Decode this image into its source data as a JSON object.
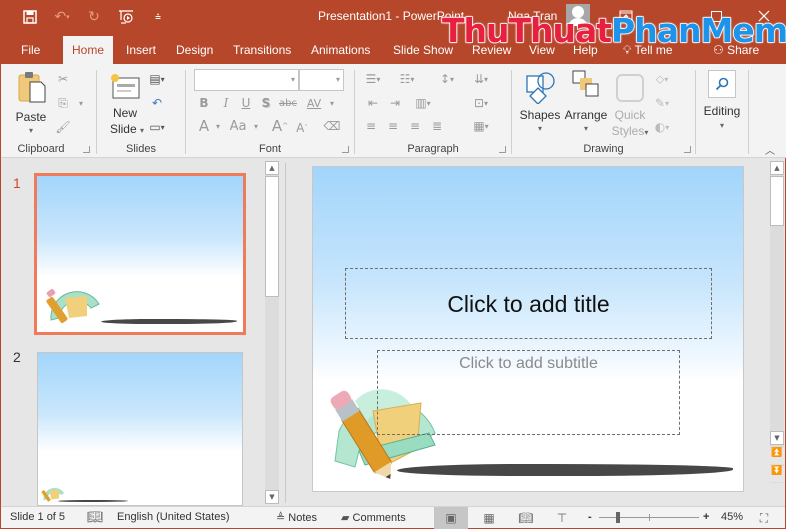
{
  "titlebar": {
    "document_title": "Presentation1  -  PowerPoint",
    "user_name": "Nga Tran",
    "qat": [
      {
        "icon": "save-icon"
      },
      {
        "icon": "undo-icon"
      },
      {
        "icon": "redo-icon"
      },
      {
        "icon": "start-from-beginning-icon"
      },
      {
        "icon": "customize-qat-icon"
      }
    ],
    "window_controls": [
      {
        "icon": "ribbon-display-options-icon",
        "glyph": "⊡"
      },
      {
        "icon": "minimize-icon",
        "glyph": "—"
      },
      {
        "icon": "maximize-icon",
        "glyph": "☐"
      },
      {
        "icon": "close-icon",
        "glyph": "✕"
      }
    ]
  },
  "watermark": {
    "part1": "ThuThuat",
    "part2": "PhanMem.vn"
  },
  "tabs": [
    {
      "label": "File"
    },
    {
      "label": "Home",
      "active": true
    },
    {
      "label": "Insert"
    },
    {
      "label": "Design"
    },
    {
      "label": "Transitions"
    },
    {
      "label": "Animations"
    },
    {
      "label": "Slide Show"
    },
    {
      "label": "Review"
    },
    {
      "label": "View"
    },
    {
      "label": "Help"
    },
    {
      "label": "Tell me"
    },
    {
      "label": "Share"
    }
  ],
  "ribbon": {
    "clipboard": {
      "label": "Clipboard",
      "paste": "Paste"
    },
    "slides": {
      "label": "Slides",
      "new_slide_line1": "New",
      "new_slide_line2": "Slide"
    },
    "font": {
      "label": "Font",
      "font_name": "",
      "font_size": "",
      "bold": "B",
      "italic": "I",
      "underline": "U",
      "shadow": "S",
      "strike": "abc",
      "spacing": "AV",
      "font_color": "A",
      "change_case": "Aa",
      "grow": "A",
      "shrink": "A"
    },
    "paragraph": {
      "label": "Paragraph"
    },
    "drawing": {
      "label": "Drawing",
      "shapes": "Shapes",
      "arrange": "Arrange",
      "quick_styles_line1": "Quick",
      "quick_styles_line2": "Styles"
    },
    "editing": {
      "label": "Editing"
    }
  },
  "thumbnails": [
    {
      "number": "1",
      "selected": true
    },
    {
      "number": "2",
      "selected": false
    }
  ],
  "slide": {
    "title_placeholder": "Click to add title",
    "subtitle_placeholder": "Click to add subtitle"
  },
  "statusbar": {
    "slide_info": "Slide 1 of 5",
    "language": "English (United States)",
    "notes": "Notes",
    "comments": "Comments",
    "zoom_minus": "-",
    "zoom_plus": "+",
    "zoom_level": "45%",
    "zoom_fraction": 0.45
  },
  "colors": {
    "accent": "#b7472a",
    "selection": "#f07b5b"
  }
}
